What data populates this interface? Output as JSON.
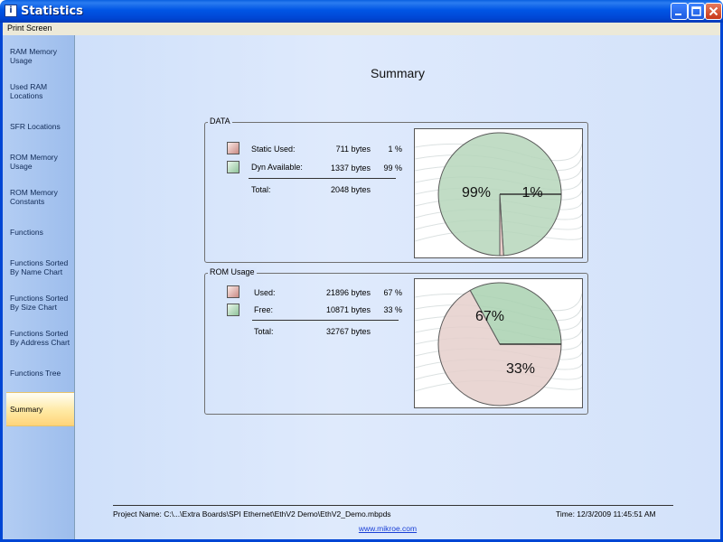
{
  "window": {
    "title": "Statistics",
    "app_icon": "info-icon"
  },
  "menu": {
    "print_screen": "Print Screen"
  },
  "sidebar": {
    "items": [
      {
        "label": "RAM Memory Usage"
      },
      {
        "label": "Used RAM Locations"
      },
      {
        "label": "SFR Locations"
      },
      {
        "label": "ROM Memory Usage"
      },
      {
        "label": "ROM Memory Constants"
      },
      {
        "label": "Functions"
      },
      {
        "label": "Functions Sorted By Name Chart"
      },
      {
        "label": "Functions Sorted By Size Chart"
      },
      {
        "label": "Functions Sorted By Address Chart"
      },
      {
        "label": "Functions Tree"
      },
      {
        "label": "Summary"
      }
    ],
    "active_index": 10
  },
  "summary": {
    "title": "Summary",
    "data_group": {
      "caption": "DATA",
      "rows": [
        {
          "label": "Static Used:",
          "value": "711 bytes",
          "percent": "1 %",
          "color": "#c98b85"
        },
        {
          "label": "Dyn Available:",
          "value": "1337 bytes",
          "percent": "99 %",
          "color": "#8fc49a"
        }
      ],
      "total_label": "Total:",
      "total_value": "2048 bytes"
    },
    "rom_group": {
      "caption": "ROM Usage",
      "rows": [
        {
          "label": "Used:",
          "value": "21896 bytes",
          "percent": "67 %",
          "color": "#c98b85"
        },
        {
          "label": "Free:",
          "value": "10871 bytes",
          "percent": "33 %",
          "color": "#8fc49a"
        }
      ],
      "total_label": "Total:",
      "total_value": "32767 bytes"
    }
  },
  "chart_data": [
    {
      "type": "pie",
      "slices": [
        {
          "label": "99%",
          "value": 99,
          "color": "#b6d6bb"
        },
        {
          "label": "1%",
          "value": 1,
          "color": "#e5c4bf"
        }
      ]
    },
    {
      "type": "pie",
      "slices": [
        {
          "label": "67%",
          "value": 67,
          "color": "#e5cfcb"
        },
        {
          "label": "33%",
          "value": 33,
          "color": "#a9d1b0"
        }
      ]
    }
  ],
  "footer": {
    "project": "Project Name: C:\\...\\Extra Boards\\SPI Ethernet\\EthV2 Demo\\EthV2_Demo.mbpds",
    "time": "Time: 12/3/2009 11:45:51 AM",
    "link": "www.mikroe.com"
  }
}
